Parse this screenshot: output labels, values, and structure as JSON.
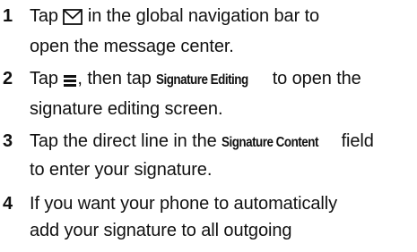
{
  "steps": [
    {
      "number": "1",
      "line1_before": "Tap ",
      "line1_icon": "envelope-icon",
      "line1_after": " in the global navigation bar to",
      "line2": "open the message center."
    },
    {
      "number": "2",
      "line1_before": "Tap ",
      "line1_icon": "menu-icon",
      "line1_mid": ", then tap ",
      "line1_ui": "Signature Editing",
      "line1_after": " to open the",
      "line2": "signature editing screen."
    },
    {
      "number": "3",
      "line1_before": "Tap the direct line in the ",
      "line1_ui": "Signature Content",
      "line1_after": " field",
      "line2": "to enter your signature."
    },
    {
      "number": "4",
      "line1": "If you want your phone to automatically",
      "line2": "add your signature to all outgoing"
    }
  ]
}
